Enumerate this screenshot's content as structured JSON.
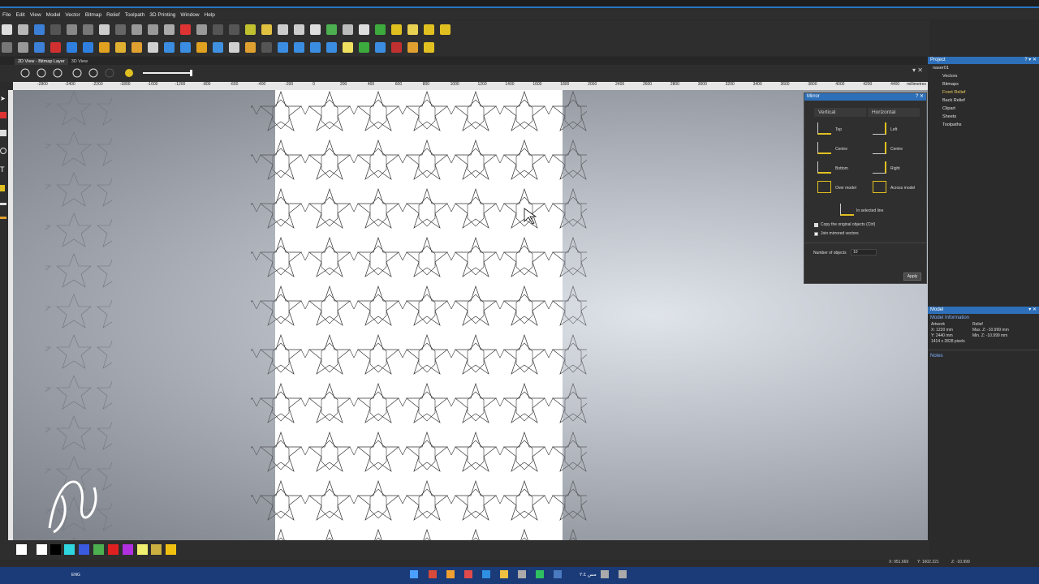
{
  "menu": [
    "File",
    "Edit",
    "View",
    "Model",
    "Vector",
    "Bitmap",
    "Relief",
    "Toolpath",
    "3D Printing",
    "Window",
    "Help"
  ],
  "tabs": [
    "2D View - Bitmap Layer",
    "3D View"
  ],
  "ruler": {
    "ticks": [
      "-2800",
      "-2400",
      "-2200",
      "-1800",
      "-1600",
      "-1200",
      "-800",
      "-600",
      "-400",
      "-200",
      "0",
      "200",
      "400",
      "600",
      "800",
      "1000",
      "1200",
      "1400",
      "1600",
      "1800",
      "2000",
      "2400",
      "2600",
      "2800",
      "3000",
      "3200",
      "3400",
      "3600",
      "3800",
      "4000",
      "4200",
      "4400"
    ],
    "unit": "millimetres"
  },
  "project": {
    "title": "Project",
    "root": "naser01",
    "items": [
      "Vectors",
      "Bitmaps",
      "Front Relief",
      "Back Relief",
      "Clipart",
      "Sheets",
      "Toolpaths"
    ]
  },
  "mirror": {
    "title": "Mirror",
    "vertical": "Vertical",
    "horizontal": "Horizontal",
    "v_opts": [
      "Top",
      "Centre",
      "Bottom",
      "Over model"
    ],
    "h_opts": [
      "Left",
      "Centre",
      "Right",
      "Across model"
    ],
    "selected_line": "In selected line",
    "copy_label": "Copy the original objects (Ctrl)",
    "join_label": "Join mirrored vectors",
    "num_label": "Number of objects",
    "num_value": "10",
    "apply": "Apply"
  },
  "model": {
    "title": "Model",
    "info_title": "Model Information",
    "artwork_label": "Artwork",
    "relief_label": "Relief",
    "x": "X: 1220 mm",
    "y": "Y: 2440 mm",
    "pixels": "1414 x 2828 pixels",
    "maxz": "Max. Z: -10.999 mm",
    "minz": "Min. Z: -10.999 mm",
    "notes": "Notes"
  },
  "status": {
    "x": "X: 951.669",
    "y": "Y: 1602.221",
    "z": "Z: -10.999"
  },
  "taskbar": {
    "lang": "ENG",
    "time": "مس ٢:٤"
  },
  "palette": [
    "#ffffff",
    "#000000",
    "#2fd6e0",
    "#3a5ae0",
    "#4caf50",
    "#e02020",
    "#b030e0",
    "#f0f070",
    "#c9b040",
    "#f0c010"
  ]
}
